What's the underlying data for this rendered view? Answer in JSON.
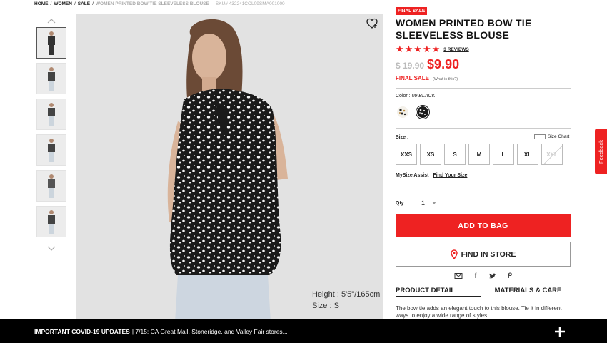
{
  "breadcrumb": {
    "items": [
      "HOME",
      "WOMEN",
      "SALE"
    ],
    "current": "WOMEN PRINTED BOW TIE SLEEVELESS BLOUSE",
    "sku": "SKU# 432241COL09SMA001000"
  },
  "product": {
    "badge": "FINAL SALE",
    "title_line1": "WOMEN PRINTED BOW TIE",
    "title_line2": "SLEEVELESS BLOUSE",
    "stars": "★★★★★",
    "rating": 5,
    "reviews": "3 REVIEWS",
    "old_price": "$ 19.90",
    "price": "$9.90",
    "final_sale": "FINAL SALE",
    "what_is_this": "(What is this?)"
  },
  "image": {
    "model_height": "Height : 5'5\"/165cm",
    "model_size": "Size : S"
  },
  "color": {
    "label": "Color :",
    "value": "09 BLACK",
    "swatches": [
      "white-print",
      "black-print"
    ]
  },
  "size": {
    "label": "Size :",
    "chart": "Size Chart",
    "options": [
      "XXS",
      "XS",
      "S",
      "M",
      "L",
      "XL",
      "XXL"
    ],
    "unavailable": [
      "XXL"
    ]
  },
  "mysize": {
    "label": "MySize Assist",
    "link": "Find Your Size"
  },
  "qty": {
    "label": "Qty :",
    "value": "1"
  },
  "buttons": {
    "add_to_bag": "ADD TO BAG",
    "find_in_store": "FIND IN STORE"
  },
  "tabs": {
    "detail": "PRODUCT DETAIL",
    "materials": "MATERIALS & CARE"
  },
  "description": "The bow tie adds an elegant touch to this blouse. Tie it in different ways to enjoy a wide range of styles.",
  "feedback": "Feedback",
  "covid": {
    "title": "IMPORTANT COVID-19 UPDATES",
    "text": "| 7/15: CA Great Mall, Stoneridge, and Valley Fair stores..."
  },
  "colors": {
    "accent": "#e22222",
    "bar": "#000000"
  }
}
